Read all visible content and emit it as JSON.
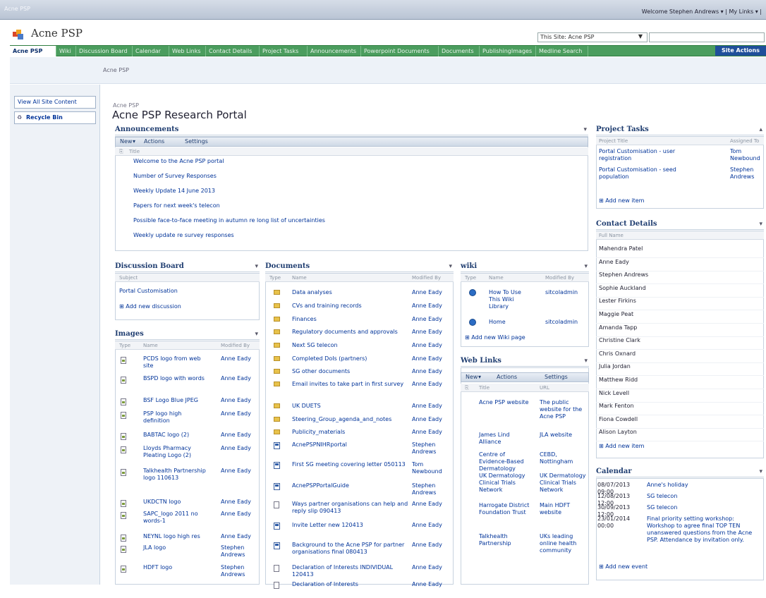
{
  "topbar": {
    "site": "Acne PSP",
    "welcome": "Welcome Stephen Andrews ▾ | My Links ▾ | "
  },
  "header": {
    "site_name": "Acne PSP",
    "search_scope": "This Site: Acne PSP"
  },
  "nav": {
    "tabs": [
      {
        "label": "Acne PSP",
        "w": 66
      },
      {
        "label": "Wiki",
        "w": 28
      },
      {
        "label": "Discussion Board",
        "w": 80
      },
      {
        "label": "Calendar",
        "w": 52
      },
      {
        "label": "Web Links",
        "w": 52
      },
      {
        "label": "Contact Details",
        "w": 76
      },
      {
        "label": "Project Tasks",
        "w": 68
      },
      {
        "label": "Announcements",
        "w": 76
      },
      {
        "label": "Powerpoint Documents",
        "w": 110
      },
      {
        "label": "Documents",
        "w": 58
      },
      {
        "label": "PublishingImages",
        "w": 80
      },
      {
        "label": "Medline Search",
        "w": 74
      }
    ],
    "site_actions": "Site Actions"
  },
  "crumbbar": {
    "text": "Acne PSP"
  },
  "leftnav": {
    "view_all": "View All Site Content",
    "recycle": "Recycle Bin"
  },
  "page": {
    "breadcrumb": "Acne PSP",
    "title": "Acne PSP Research Portal"
  },
  "announcements": {
    "title": "Announcements",
    "toolbar": {
      "new": "New",
      "actions": "Actions",
      "settings": "Settings"
    },
    "col_title": "Title",
    "items": [
      "Welcome to the Acne PSP portal",
      "Number of Survey Responses",
      "Weekly Update 14 June 2013",
      "Papers for next week's telecon",
      "Possible face-to-face meeting in autumn re long list of uncertainties",
      "Weekly update re survey responses"
    ]
  },
  "discussion": {
    "title": "Discussion Board",
    "col_subject": "Subject",
    "items": [
      "Portal Customisation"
    ],
    "add_new": "Add new discussion"
  },
  "images": {
    "title": "Images",
    "cols": [
      "Type",
      "Name",
      "Modified By"
    ],
    "items": [
      {
        "name": "PCDS logo from web site",
        "by": "Anne Eady"
      },
      {
        "name": "BSPD logo with words",
        "by": "Anne Eady"
      },
      {
        "name": "BSF Logo Blue JPEG",
        "by": "Anne Eady"
      },
      {
        "name": "PSP logo high definition",
        "by": "Anne Eady"
      },
      {
        "name": "BABTAC logo (2)",
        "by": "Anne Eady"
      },
      {
        "name": "Lloyds Pharmacy Pleating Logo (2)",
        "by": "Anne Eady"
      },
      {
        "name": "Talkhealth Partnership logo 110613",
        "by": "Anne Eady"
      },
      {
        "name": "UKDCTN logo",
        "by": "Anne Eady"
      },
      {
        "name": "SAPC_logo 2011 no words-1",
        "by": "Anne Eady"
      },
      {
        "name": "NEYNL logo high res",
        "by": "Anne Eady"
      },
      {
        "name": "JLA logo",
        "by": "Stephen Andrews"
      },
      {
        "name": "HDFT logo",
        "by": "Stephen Andrews"
      }
    ]
  },
  "documents": {
    "title": "Documents",
    "cols": [
      "Type",
      "Name",
      "Modified By"
    ],
    "items": [
      {
        "icon": "folder",
        "name": "Data analyses",
        "by": "Anne Eady"
      },
      {
        "icon": "folder",
        "name": "CVs and training records",
        "by": "Anne Eady"
      },
      {
        "icon": "folder",
        "name": "Finances",
        "by": "Anne Eady"
      },
      {
        "icon": "folder",
        "name": "Regulatory documents and approvals",
        "by": "Anne Eady"
      },
      {
        "icon": "folder",
        "name": "Next SG telecon",
        "by": "Anne Eady"
      },
      {
        "icon": "folder",
        "name": "Completed DoIs (partners)",
        "by": "Anne Eady"
      },
      {
        "icon": "folder",
        "name": "SG other documents",
        "by": "Anne Eady"
      },
      {
        "icon": "folder",
        "name": "Email invites to take part in first survey",
        "by": "Anne Eady"
      },
      {
        "icon": "folder",
        "name": "UK DUETS",
        "by": "Anne Eady"
      },
      {
        "icon": "folder",
        "name": "Steering_Group_agenda_and_notes",
        "by": "Anne Eady"
      },
      {
        "icon": "folder",
        "name": "Publicity_materials",
        "by": "Anne Eady"
      },
      {
        "icon": "word",
        "name": "AcnePSPNIHRportal",
        "by": "Stephen Andrews"
      },
      {
        "icon": "word",
        "name": "First SG meeting covering letter 050113",
        "by": "Tom Newbound"
      },
      {
        "icon": "word",
        "name": "AcnePSPPortalGuide",
        "by": "Stephen Andrews"
      },
      {
        "icon": "doc",
        "name": "Ways partner organisations can help and reply slip 090413",
        "by": "Anne Eady"
      },
      {
        "icon": "word",
        "name": "Invite Letter new 120413",
        "by": "Anne Eady"
      },
      {
        "icon": "word",
        "name": "Background to the Acne PSP for partner organisations final 080413",
        "by": "Anne Eady"
      },
      {
        "icon": "doc",
        "name": "Declaration of Interests INDIVIDUAL 120413",
        "by": "Anne Eady"
      },
      {
        "icon": "doc",
        "name": "Declaration of Interests",
        "by": "Anne Eady"
      }
    ]
  },
  "wiki": {
    "title": "wiki",
    "cols": [
      "Type",
      "Name",
      "Modified By"
    ],
    "items": [
      {
        "name": "How To Use This Wiki Library",
        "by": "sitcoladmin"
      },
      {
        "name": "Home",
        "by": "sitcoladmin"
      }
    ],
    "add_new": "Add new Wiki page"
  },
  "weblinks": {
    "title": "Web Links",
    "toolbar": {
      "new": "New",
      "actions": "Actions",
      "settings": "Settings"
    },
    "cols": [
      "Title",
      "URL"
    ],
    "items": [
      {
        "title": "Acne PSP website",
        "url": "The public website for the Acne PSP"
      },
      {
        "title": "James Lind Alliance",
        "url": "JLA website"
      },
      {
        "title": "Centre of Evidence-Based Dermatology",
        "url": "CEBD, Nottingham"
      },
      {
        "title": "UK Dermatology Clinical Trials Network",
        "url": "UK Dermatology Clinical Trials Network"
      },
      {
        "title": "Harrogate District Foundation Trust",
        "url": "Main HDFT website"
      },
      {
        "title": "Talkhealth Partnership",
        "url": "UKs leading online health community"
      }
    ]
  },
  "tasks": {
    "title": "Project Tasks",
    "cols": [
      "Project Title",
      "Assigned To"
    ],
    "items": [
      {
        "title": "Portal Customisation - user registration",
        "to": "Tom Newbound"
      },
      {
        "title": "Portal Customisation - seed population",
        "to": "Stephen Andrews"
      }
    ],
    "add_new": "Add new item"
  },
  "contacts": {
    "title": "Contact Details",
    "col": "Full Name",
    "items": [
      "Mahendra Patel",
      "Anne Eady",
      "Stephen Andrews",
      "Sophie Auckland",
      "Lester Firkins",
      "Maggie Peat",
      "Amanda Tapp",
      "Christine Clark",
      "Chris Oxnard",
      "Julia Jordan",
      "Matthew Ridd",
      "Nick Levell",
      "Mark Fenton",
      "Fiona Cowdell",
      "Alison Layton"
    ],
    "add_new": "Add new item"
  },
  "calendar": {
    "title": "Calendar",
    "items": [
      {
        "when": "08/07/2013 09:00",
        "what": "Anne's holiday"
      },
      {
        "when": "12/08/2013 12:00",
        "what": "SG telecon"
      },
      {
        "when": "30/09/2013 12:00",
        "what": "SG telecon"
      },
      {
        "when": "23/01/2014 00:00",
        "what": "Final priority setting workshop: Workshop to agree final TOP TEN unanswered questions from the Acne PSP. Attendance by invitation only."
      }
    ],
    "add_new": "Add new event"
  },
  "colors": {
    "nav": "#4b9d5e",
    "link": "#003399",
    "site_actions": "#1f4f9a"
  }
}
